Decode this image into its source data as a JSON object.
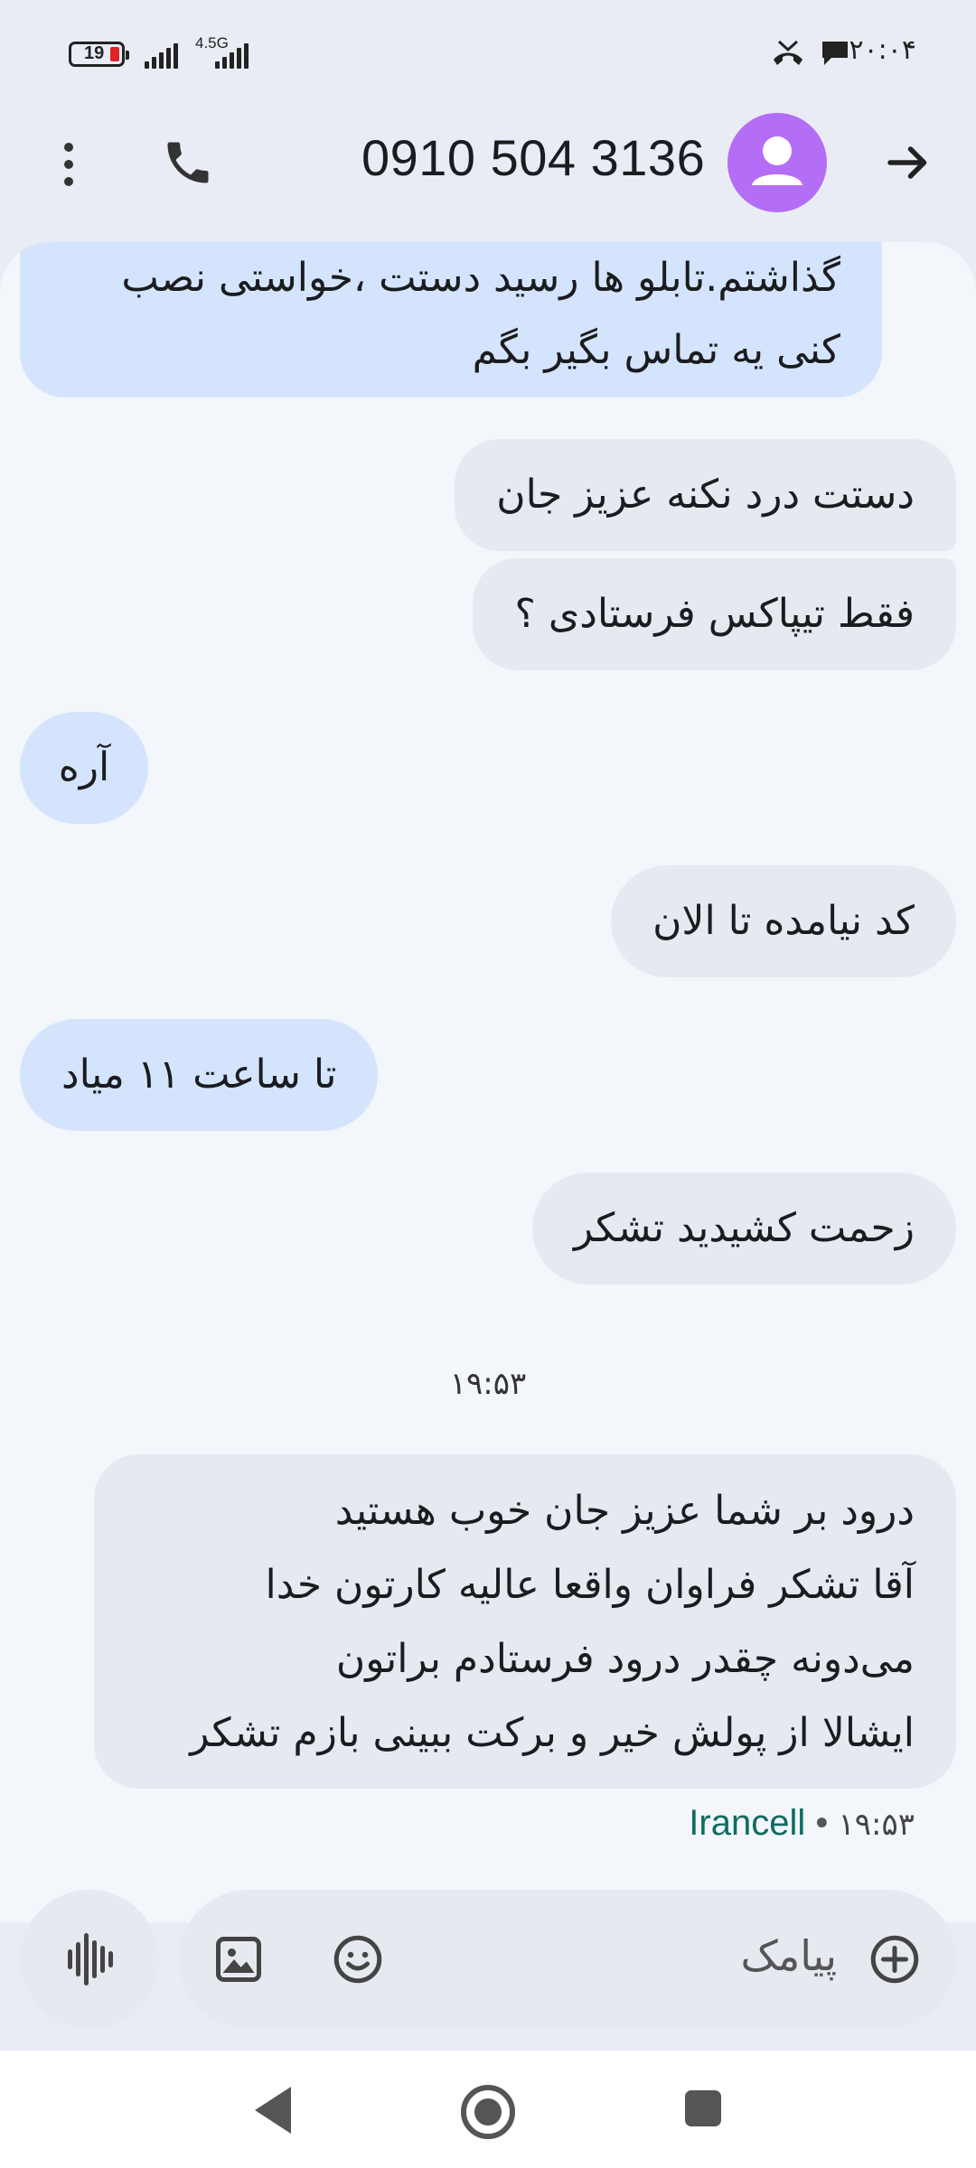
{
  "status_bar": {
    "battery_percent": "19",
    "network_type": "4.5G",
    "clock": "۲۰:۰۴"
  },
  "header": {
    "contact_number": "0910 504 3136"
  },
  "messages": [
    {
      "direction": "incoming",
      "lines": [
        "گذاشتم.تابلو ها رسید دستت ،خواستی نصب",
        "کنی یه تماس بگیر بگم"
      ]
    },
    {
      "direction": "outgoing",
      "lines": [
        "دستت درد نکنه عزیز جان"
      ]
    },
    {
      "direction": "outgoing",
      "lines": [
        "فقط تیپاکس فرستادی ؟"
      ]
    },
    {
      "direction": "incoming",
      "lines": [
        "آره"
      ]
    },
    {
      "direction": "outgoing",
      "lines": [
        "کد نیامده تا الان"
      ]
    },
    {
      "direction": "incoming",
      "lines": [
        "تا ساعت ۱۱ میاد"
      ]
    },
    {
      "direction": "outgoing",
      "lines": [
        "زحمت کشیدید تشکر"
      ]
    },
    {
      "direction": "outgoing",
      "lines": [
        "درود بر شما عزیز جان خوب هستید",
        "آقا تشکر فراوان واقعا عالیه کارتون خدا",
        "می‌دونه چقدر درود فرستادم براتون",
        "ایشالا از پولش خیر و برکت ببینی بازم تشکر"
      ]
    }
  ],
  "timestamp_divider": "۱۹:۵۳",
  "last_message_meta": {
    "carrier": "Irancell",
    "separator": "•",
    "time": "۱۹:۵۳"
  },
  "compose": {
    "placeholder": "پیامک"
  },
  "colors": {
    "incoming_bubble": "#d4e4fc",
    "outgoing_bubble": "#e6e9f0",
    "avatar": "#b46ef5",
    "carrier_text": "#0f6b62"
  }
}
